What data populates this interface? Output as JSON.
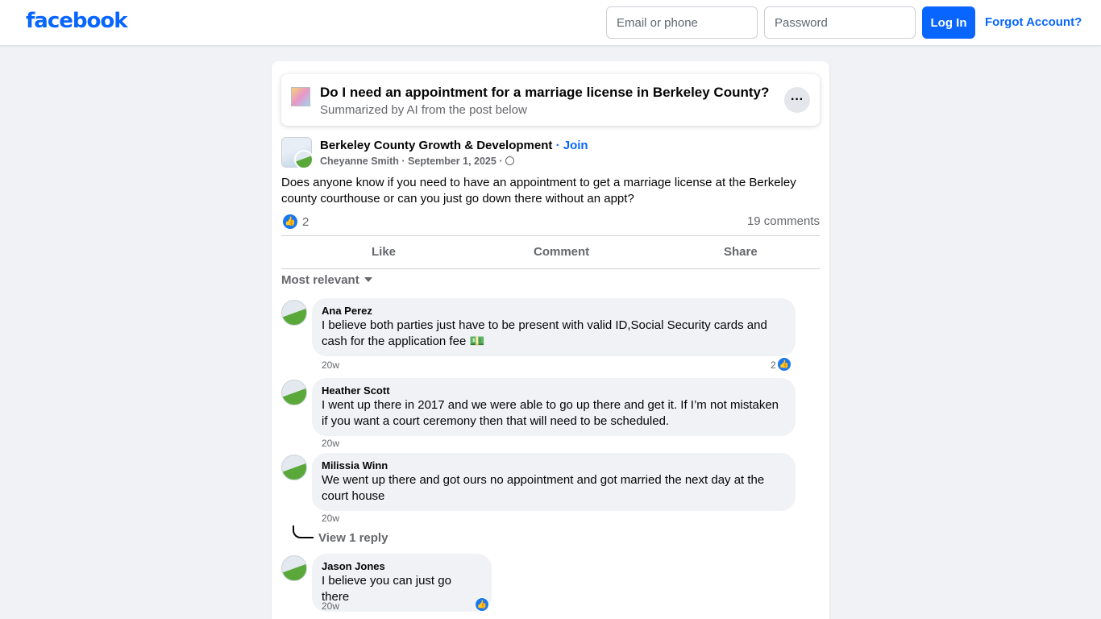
{
  "brand": {
    "logo": "facebook",
    "color": "#0866ff"
  },
  "login": {
    "email_placeholder": "Email or phone",
    "password_placeholder": "Password",
    "login_label": "Log In",
    "forgot_label": "Forgot Account?"
  },
  "ai_summary": {
    "title": "Do I need an appointment for a marriage license in Berkeley County?",
    "subtitle": "Summarized by AI from the post below",
    "more_label": "···"
  },
  "post": {
    "group_name": "Berkeley County Growth & Development",
    "join_sep": " · ",
    "join_label": "Join",
    "author": "Cheyanne Smith",
    "date": "September 1, 2025",
    "text": "Does anyone know if you need to have an appointment to get a marriage license at the Berkeley county courthouse or can you just go down there without an appt?",
    "like_count": "2",
    "comments_count": "19 comments",
    "actions": {
      "like": "Like",
      "comment": "Comment",
      "share": "Share"
    }
  },
  "sort_label": "Most relevant",
  "comments": [
    {
      "name": "Ana Perez",
      "text": "I believe both parties just have to be present with valid ID,Social Security cards and cash for the application fee 💵",
      "time": "20w",
      "likes": "2"
    },
    {
      "name": "Heather Scott",
      "text": "I went up there in 2017 and we were able to go up there and get it. If I’m not mistaken if you want a court ceremony then that will need to be scheduled.",
      "time": "20w"
    },
    {
      "name": "Milissia Winn",
      "text": "We went up there and got ours no appointment and got married the next day at the court house",
      "time": "20w",
      "view_replies": "View 1 reply"
    },
    {
      "name": "Jason Jones",
      "text": "I believe you can just go there",
      "time": "20w"
    }
  ]
}
